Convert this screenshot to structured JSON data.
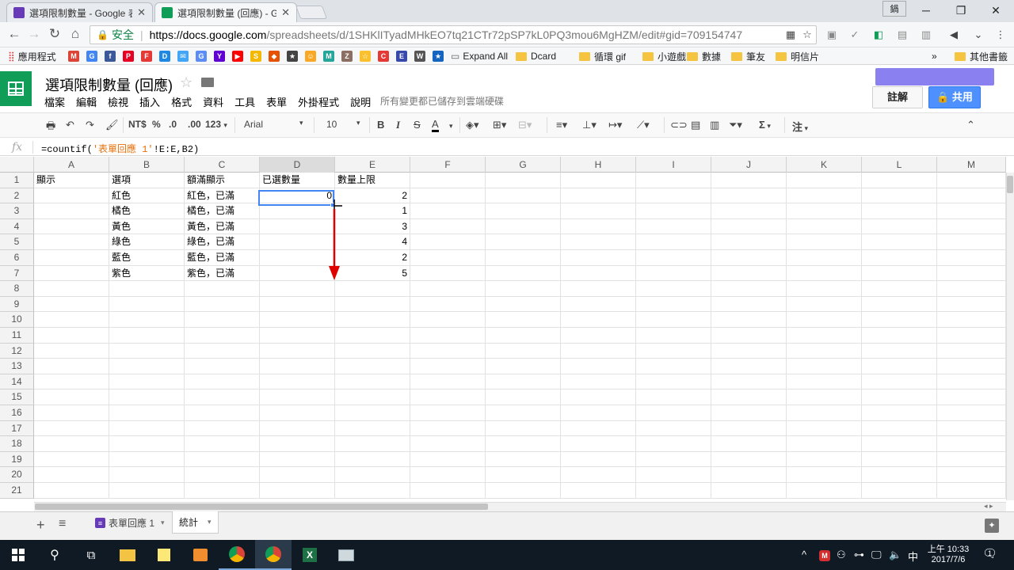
{
  "browser": {
    "tabs": [
      {
        "title": "選項限制數量 - Google 表單",
        "color": "#673ab7"
      },
      {
        "title": "選項限制數量 (回應) - Google 試算表",
        "color": "#0f9d58"
      }
    ],
    "window_user": "鍋",
    "secure_label": "安全",
    "url_host": "https://docs.google.com",
    "url_path": "/spreadsheets/d/1SHKlITyadMHkEO7tq21CTr72pSP7kL0PQ3mou6MgHZM/edit#gid=709154747",
    "bookmarks": [
      {
        "label": "應用程式",
        "type": "apps"
      },
      {
        "label": "M",
        "type": "icon",
        "color": "#db4437"
      },
      {
        "label": "G",
        "type": "icon",
        "color": "#4285f4"
      },
      {
        "label": "f",
        "type": "icon",
        "color": "#3b5998"
      },
      {
        "label": "P",
        "type": "icon",
        "color": "#e60023"
      },
      {
        "label": "F",
        "type": "icon",
        "color": "#e53935"
      },
      {
        "label": "D",
        "type": "icon",
        "color": "#1e88e5"
      },
      {
        "label": "✉",
        "type": "icon",
        "color": "#42a5f5"
      },
      {
        "label": "G",
        "type": "icon",
        "color": "#5c8df6"
      },
      {
        "label": "Y",
        "type": "icon",
        "color": "#5f01d1"
      },
      {
        "label": "▶",
        "type": "icon",
        "color": "#ff0000"
      },
      {
        "label": "S",
        "type": "icon",
        "color": "#f5b800"
      },
      {
        "label": "◆",
        "type": "icon",
        "color": "#e65100"
      },
      {
        "label": "★",
        "type": "icon",
        "color": "#444444"
      },
      {
        "label": "☺",
        "type": "icon",
        "color": "#f9a825"
      },
      {
        "label": "M",
        "type": "icon",
        "color": "#26a69a"
      },
      {
        "label": "Z",
        "type": "icon",
        "color": "#8d6e63"
      },
      {
        "label": "☆",
        "type": "icon",
        "color": "#fbc02d"
      },
      {
        "label": "C",
        "type": "icon",
        "color": "#e53935"
      },
      {
        "label": "E",
        "type": "icon",
        "color": "#3949ab"
      },
      {
        "label": "W",
        "type": "icon",
        "color": "#555555"
      },
      {
        "label": "★",
        "type": "icon",
        "color": "#1565c0"
      },
      {
        "label": "Expand All",
        "type": "page"
      },
      {
        "label": "Dcard",
        "type": "folder"
      },
      {
        "label": "循環 gif",
        "type": "folder"
      },
      {
        "label": "小遊戲",
        "type": "folder"
      },
      {
        "label": "數據",
        "type": "folder"
      },
      {
        "label": "筆友",
        "type": "folder"
      },
      {
        "label": "明信片",
        "type": "folder"
      }
    ],
    "more_bookmarks": "»",
    "other_bookmarks": "其他書籤"
  },
  "sheets": {
    "doc_title": "選項限制數量 (回應)",
    "menus": [
      "檔案",
      "編輯",
      "檢視",
      "插入",
      "格式",
      "資料",
      "工具",
      "表單",
      "外掛程式",
      "說明"
    ],
    "save_status": "所有變更都已儲存到雲端硬碟",
    "comment_label": "註解",
    "share_label": "共用",
    "toolbar": {
      "currency": "NT$",
      "percent": "%",
      "dec_less": ".0",
      "dec_more": ".00",
      "more_formats": "123",
      "font": "Arial",
      "font_size": "10",
      "bold": "B",
      "italic": "I",
      "strike": "S",
      "text_color": "A",
      "functions": "Σ",
      "input_tools": "注"
    },
    "fx": "fx",
    "formula_prefix": "=countif(",
    "formula_string": "'表單回應 1'",
    "formula_suffix": "!E:E,B2)",
    "columns": [
      "A",
      "B",
      "C",
      "D",
      "E",
      "F",
      "G",
      "H",
      "I",
      "J",
      "K",
      "L",
      "M"
    ],
    "selected_column": "D",
    "rows": [
      "1",
      "2",
      "3",
      "4",
      "5",
      "6",
      "7",
      "8",
      "9",
      "10",
      "11",
      "12",
      "13",
      "14",
      "15",
      "16",
      "17",
      "18",
      "19",
      "20",
      "21"
    ],
    "headers": {
      "A": "顯示",
      "B": "選項",
      "C": "額滿顯示",
      "D": "已選數量",
      "E": "數量上限"
    },
    "data": [
      {
        "B": "紅色",
        "C": "紅色，已滿",
        "D": "0",
        "E": "2"
      },
      {
        "B": "橘色",
        "C": "橘色，已滿",
        "D": "",
        "E": "1"
      },
      {
        "B": "黃色",
        "C": "黃色，已滿",
        "D": "",
        "E": "3"
      },
      {
        "B": "綠色",
        "C": "綠色，已滿",
        "D": "",
        "E": "4"
      },
      {
        "B": "藍色",
        "C": "藍色，已滿",
        "D": "",
        "E": "2"
      },
      {
        "B": "紫色",
        "C": "紫色，已滿",
        "D": "",
        "E": "5"
      }
    ],
    "sheet_tabs": [
      "表單回應 1",
      "統計"
    ],
    "active_sheet": "統計",
    "annotation_color": "#e00000"
  },
  "taskbar": {
    "ime": "中",
    "time": "上午 10:33",
    "date": "2017/7/6",
    "notification_count": "1"
  }
}
